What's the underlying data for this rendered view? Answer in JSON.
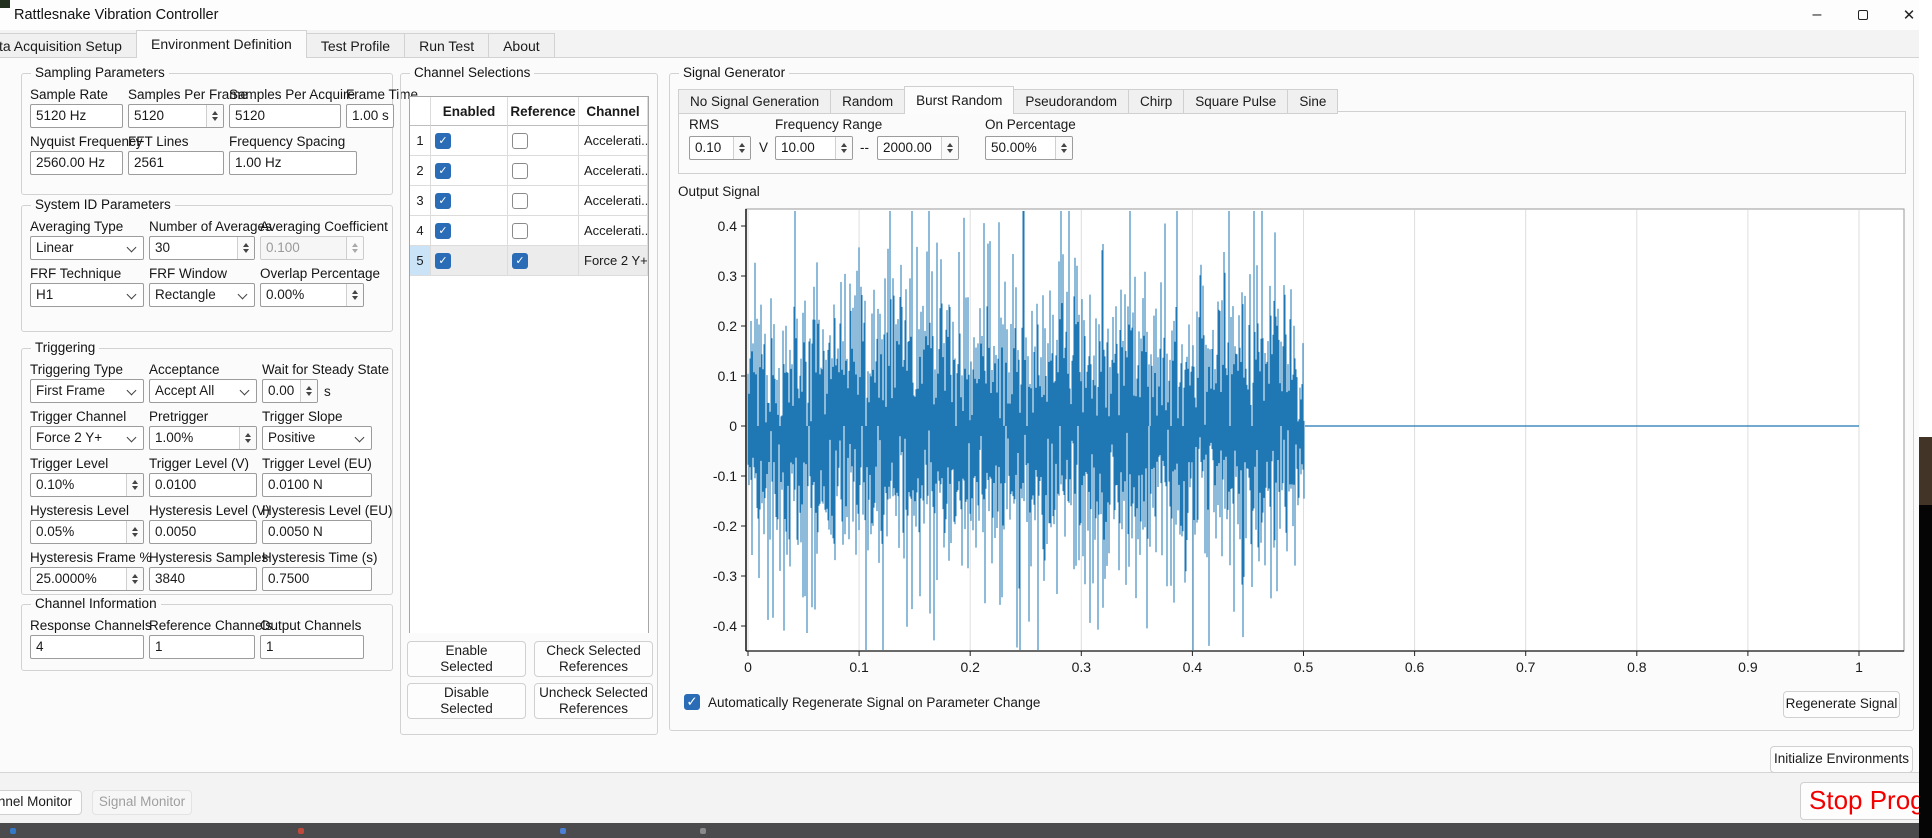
{
  "window": {
    "title": "Rattlesnake Vibration Controller",
    "minimize_glyph": "–",
    "close_glyph": "✕"
  },
  "main_tabs": [
    {
      "label": "ta Acquisition Setup"
    },
    {
      "label": "Environment Definition",
      "active": true
    },
    {
      "label": "Test Profile"
    },
    {
      "label": "Run Test"
    },
    {
      "label": "About"
    }
  ],
  "panels": {
    "sampling": {
      "title": "Sampling Parameters",
      "rows": [
        [
          {
            "label": "Sample Rate",
            "value": "5120 Hz",
            "type": "text"
          },
          {
            "label": "Samples Per Frame",
            "value": "5120",
            "type": "spin"
          },
          {
            "label": "Samples Per Acquire",
            "value": "5120",
            "type": "text"
          },
          {
            "label": "Frame Time",
            "value": "1.00 s",
            "type": "text"
          }
        ],
        [
          {
            "label": "Nyquist Frequency",
            "value": "2560.00 Hz",
            "type": "text"
          },
          {
            "label": "FFT Lines",
            "value": "2561",
            "type": "text"
          },
          {
            "label": "Frequency Spacing",
            "value": "1.00 Hz",
            "type": "text"
          }
        ]
      ]
    },
    "system": {
      "title": "System ID Parameters",
      "rows": [
        [
          {
            "label": "Averaging Type",
            "value": "Linear",
            "type": "combo"
          },
          {
            "label": "Number of Averages",
            "value": "30",
            "type": "spin"
          },
          {
            "label": "Averaging Coefficient",
            "value": "0.100",
            "type": "spin",
            "disabled": true
          }
        ],
        [
          {
            "label": "FRF Technique",
            "value": "H1",
            "type": "combo"
          },
          {
            "label": "FRF Window",
            "value": "Rectangle",
            "type": "combo"
          },
          {
            "label": "Overlap Percentage",
            "value": "0.00%",
            "type": "spin"
          }
        ]
      ]
    },
    "trigger": {
      "title": "Triggering",
      "rows": [
        [
          {
            "label": "Triggering Type",
            "value": "First Frame",
            "type": "combo"
          },
          {
            "label": "Acceptance",
            "value": "Accept All",
            "type": "combo"
          },
          {
            "label": "Wait for Steady State",
            "value": "0.00",
            "type": "spin",
            "cls": "narrow",
            "suffix": "s"
          }
        ],
        [
          {
            "label": "Trigger Channel",
            "value": "Force 2 Y+",
            "type": "combo"
          },
          {
            "label": "Pretrigger",
            "value": "1.00%",
            "type": "spin"
          },
          {
            "label": "Trigger Slope",
            "value": "Positive",
            "type": "combo"
          }
        ],
        [
          {
            "label": "Trigger Level",
            "value": "0.10%",
            "type": "spin"
          },
          {
            "label": "Trigger Level (V)",
            "value": "0.0100",
            "type": "text"
          },
          {
            "label": "Trigger Level (EU)",
            "value": "0.0100 N",
            "type": "text"
          }
        ],
        [
          {
            "label": "Hysteresis Level",
            "value": "0.05%",
            "type": "spin"
          },
          {
            "label": "Hysteresis Level (V)",
            "value": "0.0050",
            "type": "text"
          },
          {
            "label": "Hysteresis Level (EU)",
            "value": "0.0050 N",
            "type": "text"
          }
        ],
        [
          {
            "label": "Hysteresis Frame %",
            "value": "25.0000%",
            "type": "spin"
          },
          {
            "label": "Hysteresis Samples",
            "value": "3840",
            "type": "text"
          },
          {
            "label": "Hysteresis Time (s)",
            "value": "0.7500",
            "type": "text"
          }
        ]
      ]
    },
    "chinfo": {
      "title": "Channel Information",
      "rows": [
        [
          {
            "label": "Response Channels",
            "value": "4",
            "type": "text"
          },
          {
            "label": "Reference Channels",
            "value": "1",
            "type": "text"
          },
          {
            "label": "Output Channels",
            "value": "1",
            "type": "text"
          }
        ]
      ]
    }
  },
  "channel_selections": {
    "title": "Channel Selections",
    "columns": [
      "Enabled",
      "Reference",
      "Channel"
    ],
    "rows": [
      {
        "num": "1",
        "enabled": true,
        "reference": false,
        "channel": "Accelerati..."
      },
      {
        "num": "2",
        "enabled": true,
        "reference": false,
        "channel": "Accelerati..."
      },
      {
        "num": "3",
        "enabled": true,
        "reference": false,
        "channel": "Accelerati..."
      },
      {
        "num": "4",
        "enabled": true,
        "reference": false,
        "channel": "Accelerati..."
      },
      {
        "num": "5",
        "enabled": true,
        "reference": true,
        "channel": "Force 2 Y+",
        "selected": true
      }
    ],
    "buttons": [
      "Enable\nSelected",
      "Check Selected\nReferences",
      "Disable\nSelected",
      "Uncheck Selected\nReferences"
    ]
  },
  "signal_generator": {
    "title": "Signal Generator",
    "tabs": [
      {
        "label": "No Signal Generation"
      },
      {
        "label": "Random"
      },
      {
        "label": "Burst Random",
        "active": true
      },
      {
        "label": "Pseudorandom"
      },
      {
        "label": "Chirp"
      },
      {
        "label": "Square Pulse"
      },
      {
        "label": "Sine"
      }
    ],
    "burst": {
      "rms_label": "RMS",
      "rms": "0.10",
      "volts": "V",
      "freq_label": "Frequency Range",
      "freq_lo": "10.00",
      "dash": "--",
      "freq_hi": "2000.00",
      "on_label": "On Percentage",
      "on": "50.00%"
    },
    "output_label": "Output Signal",
    "auto_regen": "Automatically Regenerate Signal on Parameter Change",
    "regen_btn": "Regenerate Signal"
  },
  "footer": {
    "init_btn": "Initialize Environments",
    "monitor1": "nnel Monitor",
    "monitor2": "Signal Monitor",
    "stop": "Stop Program"
  },
  "colors": {
    "accent": "#2a6cb5",
    "plot_line": "#1f77b4",
    "stop_red": "#f20000"
  },
  "chart_data": {
    "type": "line",
    "title": "Output Signal",
    "xlabel": "",
    "ylabel": "",
    "xlim": [
      -0.002,
      1.04
    ],
    "ylim": [
      -0.45,
      0.434
    ],
    "xticks": [
      0,
      0.1,
      0.2,
      0.3,
      0.4,
      0.5,
      0.6,
      0.7,
      0.8,
      0.9,
      1
    ],
    "xtick_labels": [
      "0",
      "0.1",
      "0.2",
      "0.3",
      "0.4",
      "0.5",
      "0.6",
      "0.7",
      "0.8",
      "0.9",
      "1"
    ],
    "yticks": [
      0.4,
      0.3,
      0.2,
      0.1,
      0,
      -0.1,
      -0.2,
      -0.3,
      -0.4
    ],
    "ytick_labels": [
      "0.4",
      "0.3",
      "0.2",
      "0.1",
      "0",
      "-0.1",
      "-0.2",
      "-0.3",
      "-0.4"
    ],
    "grid": "vertical-only",
    "legend": "none",
    "series": [
      {
        "name": "output_signal",
        "kind": "burst_random_noise",
        "rms": 0.1,
        "burst_start": 0.0,
        "burst_end": 0.5,
        "signal_end": 1.0,
        "peak_positive": 0.405,
        "peak_negative": -0.443,
        "color": "#1f77b4",
        "seed": 7
      }
    ]
  }
}
